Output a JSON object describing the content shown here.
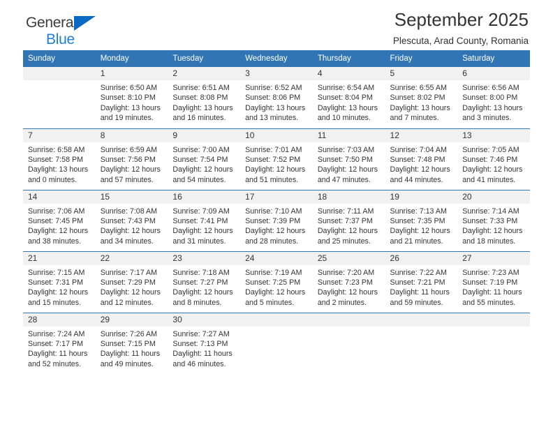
{
  "brand": {
    "name_line1": "General",
    "name_line2": "Blue",
    "accent_color": "#1f7fd4",
    "triangle_color": "#0a69c4"
  },
  "header": {
    "title": "September 2025",
    "subtitle": "Plescuta, Arad County, Romania",
    "header_bg_color": "#3275b5",
    "header_text_color": "#ffffff",
    "daynum_bg_color": "#f1f1f1"
  },
  "weekday_headers": [
    "Sunday",
    "Monday",
    "Tuesday",
    "Wednesday",
    "Thursday",
    "Friday",
    "Saturday"
  ],
  "weeks": [
    [
      {
        "day": "",
        "sunrise": "",
        "sunset": "",
        "daylight_line1": "",
        "daylight_line2": ""
      },
      {
        "day": "1",
        "sunrise": "Sunrise: 6:50 AM",
        "sunset": "Sunset: 8:10 PM",
        "daylight_line1": "Daylight: 13 hours",
        "daylight_line2": "and 19 minutes."
      },
      {
        "day": "2",
        "sunrise": "Sunrise: 6:51 AM",
        "sunset": "Sunset: 8:08 PM",
        "daylight_line1": "Daylight: 13 hours",
        "daylight_line2": "and 16 minutes."
      },
      {
        "day": "3",
        "sunrise": "Sunrise: 6:52 AM",
        "sunset": "Sunset: 8:06 PM",
        "daylight_line1": "Daylight: 13 hours",
        "daylight_line2": "and 13 minutes."
      },
      {
        "day": "4",
        "sunrise": "Sunrise: 6:54 AM",
        "sunset": "Sunset: 8:04 PM",
        "daylight_line1": "Daylight: 13 hours",
        "daylight_line2": "and 10 minutes."
      },
      {
        "day": "5",
        "sunrise": "Sunrise: 6:55 AM",
        "sunset": "Sunset: 8:02 PM",
        "daylight_line1": "Daylight: 13 hours",
        "daylight_line2": "and 7 minutes."
      },
      {
        "day": "6",
        "sunrise": "Sunrise: 6:56 AM",
        "sunset": "Sunset: 8:00 PM",
        "daylight_line1": "Daylight: 13 hours",
        "daylight_line2": "and 3 minutes."
      }
    ],
    [
      {
        "day": "7",
        "sunrise": "Sunrise: 6:58 AM",
        "sunset": "Sunset: 7:58 PM",
        "daylight_line1": "Daylight: 13 hours",
        "daylight_line2": "and 0 minutes."
      },
      {
        "day": "8",
        "sunrise": "Sunrise: 6:59 AM",
        "sunset": "Sunset: 7:56 PM",
        "daylight_line1": "Daylight: 12 hours",
        "daylight_line2": "and 57 minutes."
      },
      {
        "day": "9",
        "sunrise": "Sunrise: 7:00 AM",
        "sunset": "Sunset: 7:54 PM",
        "daylight_line1": "Daylight: 12 hours",
        "daylight_line2": "and 54 minutes."
      },
      {
        "day": "10",
        "sunrise": "Sunrise: 7:01 AM",
        "sunset": "Sunset: 7:52 PM",
        "daylight_line1": "Daylight: 12 hours",
        "daylight_line2": "and 51 minutes."
      },
      {
        "day": "11",
        "sunrise": "Sunrise: 7:03 AM",
        "sunset": "Sunset: 7:50 PM",
        "daylight_line1": "Daylight: 12 hours",
        "daylight_line2": "and 47 minutes."
      },
      {
        "day": "12",
        "sunrise": "Sunrise: 7:04 AM",
        "sunset": "Sunset: 7:48 PM",
        "daylight_line1": "Daylight: 12 hours",
        "daylight_line2": "and 44 minutes."
      },
      {
        "day": "13",
        "sunrise": "Sunrise: 7:05 AM",
        "sunset": "Sunset: 7:46 PM",
        "daylight_line1": "Daylight: 12 hours",
        "daylight_line2": "and 41 minutes."
      }
    ],
    [
      {
        "day": "14",
        "sunrise": "Sunrise: 7:06 AM",
        "sunset": "Sunset: 7:45 PM",
        "daylight_line1": "Daylight: 12 hours",
        "daylight_line2": "and 38 minutes."
      },
      {
        "day": "15",
        "sunrise": "Sunrise: 7:08 AM",
        "sunset": "Sunset: 7:43 PM",
        "daylight_line1": "Daylight: 12 hours",
        "daylight_line2": "and 34 minutes."
      },
      {
        "day": "16",
        "sunrise": "Sunrise: 7:09 AM",
        "sunset": "Sunset: 7:41 PM",
        "daylight_line1": "Daylight: 12 hours",
        "daylight_line2": "and 31 minutes."
      },
      {
        "day": "17",
        "sunrise": "Sunrise: 7:10 AM",
        "sunset": "Sunset: 7:39 PM",
        "daylight_line1": "Daylight: 12 hours",
        "daylight_line2": "and 28 minutes."
      },
      {
        "day": "18",
        "sunrise": "Sunrise: 7:11 AM",
        "sunset": "Sunset: 7:37 PM",
        "daylight_line1": "Daylight: 12 hours",
        "daylight_line2": "and 25 minutes."
      },
      {
        "day": "19",
        "sunrise": "Sunrise: 7:13 AM",
        "sunset": "Sunset: 7:35 PM",
        "daylight_line1": "Daylight: 12 hours",
        "daylight_line2": "and 21 minutes."
      },
      {
        "day": "20",
        "sunrise": "Sunrise: 7:14 AM",
        "sunset": "Sunset: 7:33 PM",
        "daylight_line1": "Daylight: 12 hours",
        "daylight_line2": "and 18 minutes."
      }
    ],
    [
      {
        "day": "21",
        "sunrise": "Sunrise: 7:15 AM",
        "sunset": "Sunset: 7:31 PM",
        "daylight_line1": "Daylight: 12 hours",
        "daylight_line2": "and 15 minutes."
      },
      {
        "day": "22",
        "sunrise": "Sunrise: 7:17 AM",
        "sunset": "Sunset: 7:29 PM",
        "daylight_line1": "Daylight: 12 hours",
        "daylight_line2": "and 12 minutes."
      },
      {
        "day": "23",
        "sunrise": "Sunrise: 7:18 AM",
        "sunset": "Sunset: 7:27 PM",
        "daylight_line1": "Daylight: 12 hours",
        "daylight_line2": "and 8 minutes."
      },
      {
        "day": "24",
        "sunrise": "Sunrise: 7:19 AM",
        "sunset": "Sunset: 7:25 PM",
        "daylight_line1": "Daylight: 12 hours",
        "daylight_line2": "and 5 minutes."
      },
      {
        "day": "25",
        "sunrise": "Sunrise: 7:20 AM",
        "sunset": "Sunset: 7:23 PM",
        "daylight_line1": "Daylight: 12 hours",
        "daylight_line2": "and 2 minutes."
      },
      {
        "day": "26",
        "sunrise": "Sunrise: 7:22 AM",
        "sunset": "Sunset: 7:21 PM",
        "daylight_line1": "Daylight: 11 hours",
        "daylight_line2": "and 59 minutes."
      },
      {
        "day": "27",
        "sunrise": "Sunrise: 7:23 AM",
        "sunset": "Sunset: 7:19 PM",
        "daylight_line1": "Daylight: 11 hours",
        "daylight_line2": "and 55 minutes."
      }
    ],
    [
      {
        "day": "28",
        "sunrise": "Sunrise: 7:24 AM",
        "sunset": "Sunset: 7:17 PM",
        "daylight_line1": "Daylight: 11 hours",
        "daylight_line2": "and 52 minutes."
      },
      {
        "day": "29",
        "sunrise": "Sunrise: 7:26 AM",
        "sunset": "Sunset: 7:15 PM",
        "daylight_line1": "Daylight: 11 hours",
        "daylight_line2": "and 49 minutes."
      },
      {
        "day": "30",
        "sunrise": "Sunrise: 7:27 AM",
        "sunset": "Sunset: 7:13 PM",
        "daylight_line1": "Daylight: 11 hours",
        "daylight_line2": "and 46 minutes."
      },
      {
        "day": "",
        "sunrise": "",
        "sunset": "",
        "daylight_line1": "",
        "daylight_line2": ""
      },
      {
        "day": "",
        "sunrise": "",
        "sunset": "",
        "daylight_line1": "",
        "daylight_line2": ""
      },
      {
        "day": "",
        "sunrise": "",
        "sunset": "",
        "daylight_line1": "",
        "daylight_line2": ""
      },
      {
        "day": "",
        "sunrise": "",
        "sunset": "",
        "daylight_line1": "",
        "daylight_line2": ""
      }
    ]
  ]
}
